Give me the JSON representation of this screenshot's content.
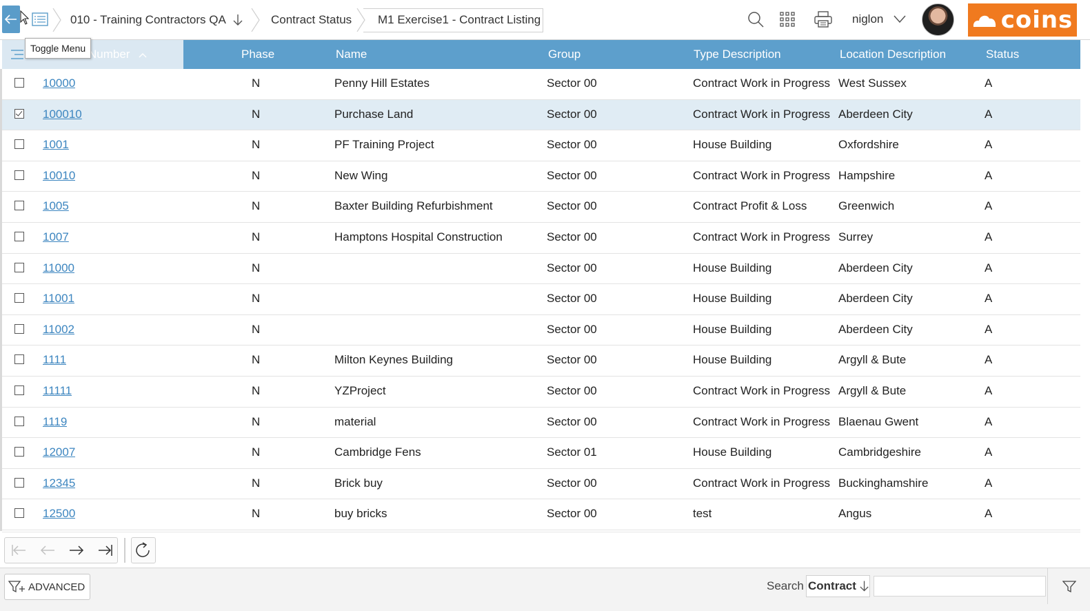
{
  "breadcrumb": {
    "company": "010 - Training Contractors QA",
    "items": [
      "Contract Status",
      "M1 Exercise1 - Contract Listing"
    ]
  },
  "header": {
    "user": "niglon",
    "logo_text": "coins",
    "icons": [
      "back-arrow-icon",
      "list-icon",
      "search-icon",
      "apps-grid-icon",
      "print-icon",
      "chevron-down-icon"
    ]
  },
  "tooltip": "Toggle Menu",
  "grid": {
    "columns": {
      "number": "Number",
      "phase": "Phase",
      "name": "Name",
      "group": "Group",
      "type": "Type Description",
      "location": "Location Description",
      "status": "Status"
    },
    "rows": [
      {
        "number": "10000",
        "phase": "N",
        "name": "Penny Hill Estates",
        "group": "Sector 00",
        "type": "Contract Work in Progress",
        "location": "West Sussex",
        "status": "A"
      },
      {
        "number": "100010",
        "phase": "N",
        "name": "Purchase Land",
        "group": "Sector 00",
        "type": "Contract Work in Progress",
        "location": "Aberdeen City",
        "status": "A"
      },
      {
        "number": "1001",
        "phase": "N",
        "name": "PF Training Project",
        "group": "Sector 00",
        "type": "House Building",
        "location": "Oxfordshire",
        "status": "A"
      },
      {
        "number": "10010",
        "phase": "N",
        "name": "New Wing",
        "group": "Sector 00",
        "type": "Contract Work in Progress",
        "location": "Hampshire",
        "status": "A"
      },
      {
        "number": "1005",
        "phase": "N",
        "name": "Baxter Building Refurbishment",
        "group": "Sector 00",
        "type": "Contract Profit & Loss",
        "location": "Greenwich",
        "status": "A"
      },
      {
        "number": "1007",
        "phase": "N",
        "name": "Hamptons Hospital Construction",
        "group": "Sector 00",
        "type": "Contract Work in Progress",
        "location": "Surrey",
        "status": "A"
      },
      {
        "number": "11000",
        "phase": "N",
        "name": "",
        "group": "Sector 00",
        "type": "House Building",
        "location": "Aberdeen City",
        "status": "A"
      },
      {
        "number": "11001",
        "phase": "N",
        "name": "",
        "group": "Sector 00",
        "type": "House Building",
        "location": "Aberdeen City",
        "status": "A"
      },
      {
        "number": "11002",
        "phase": "N",
        "name": "",
        "group": "Sector 00",
        "type": "House Building",
        "location": "Aberdeen City",
        "status": "A"
      },
      {
        "number": "1111",
        "phase": "N",
        "name": "Milton Keynes Building",
        "group": "Sector 00",
        "type": "House Building",
        "location": "Argyll & Bute",
        "status": "A"
      },
      {
        "number": "11111",
        "phase": "N",
        "name": "YZProject",
        "group": "Sector 00",
        "type": "Contract Work in Progress",
        "location": "Argyll & Bute",
        "status": "A"
      },
      {
        "number": "1119",
        "phase": "N",
        "name": "material",
        "group": "Sector 00",
        "type": "Contract Work in Progress",
        "location": "Blaenau Gwent",
        "status": "A"
      },
      {
        "number": "12007",
        "phase": "N",
        "name": "Cambridge Fens",
        "group": "Sector 01",
        "type": "House Building",
        "location": "Cambridgeshire",
        "status": "A"
      },
      {
        "number": "12345",
        "phase": "N",
        "name": "Brick buy",
        "group": "Sector 00",
        "type": "Contract Work in Progress",
        "location": "Buckinghamshire",
        "status": "A"
      },
      {
        "number": "12500",
        "phase": "N",
        "name": "buy bricks",
        "group": "Sector 00",
        "type": "test",
        "location": "Angus",
        "status": "A"
      }
    ],
    "selected_row": 1
  },
  "footer": {
    "advanced_label": "ADVANCED",
    "search_label": "Search",
    "search_field": "Contract",
    "search_value": ""
  },
  "colors": {
    "header_blue": "#5d9fcc",
    "accent_orange": "#f07a1f",
    "link_blue": "#3d86c0",
    "selected_row": "#e0ecf4"
  }
}
